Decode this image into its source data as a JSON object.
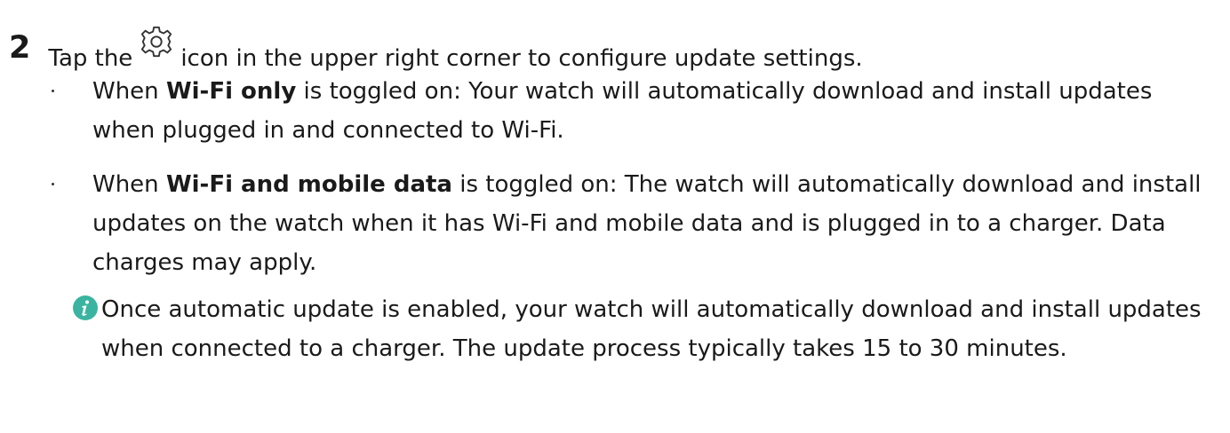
{
  "step": {
    "number": "2",
    "text_before_icon": "Tap the",
    "icon": "gear-icon",
    "text_after_icon": "icon in the upper right corner to configure update settings."
  },
  "bullets": [
    {
      "prefix": "When ",
      "bold": "Wi-Fi only",
      "rest": " is toggled on: Your watch will automatically download and install updates when plugged in and connected to Wi-Fi."
    },
    {
      "prefix": "When ",
      "bold": "Wi-Fi and mobile data",
      "rest": " is toggled on: The watch will automatically download and install updates on the watch when it has Wi-Fi and mobile data and is plugged in to a charger. Data charges may apply."
    }
  ],
  "note": {
    "icon": "info-icon",
    "text": "Once automatic update is enabled, your watch will automatically download and install updates when connected to a charger. The update process typically takes 15 to 30 minutes."
  },
  "colors": {
    "text": "#1a1a1a",
    "info_icon": "#3ab4a0"
  }
}
